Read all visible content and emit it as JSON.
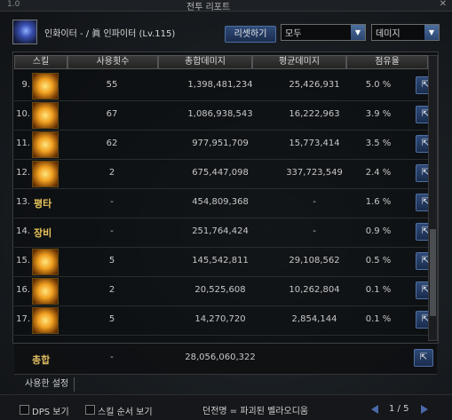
{
  "window": {
    "title": "전투 리포트",
    "version": "1.0"
  },
  "header": {
    "character": "인화이터 - / 眞 인파이터 (Lv.115)",
    "reset_label": "리셋하기",
    "filter1": "모두",
    "filter2": "데미지"
  },
  "table": {
    "columns": [
      "스킬",
      "사용횟수",
      "총합데미지",
      "평균데미지",
      "점유율"
    ],
    "rows": [
      {
        "num": "9.",
        "type": "icon",
        "name": "",
        "count": "55",
        "total": "1,398,481,234",
        "avg": "25,426,931",
        "share": "5.0 %"
      },
      {
        "num": "10.",
        "type": "icon",
        "name": "",
        "count": "67",
        "total": "1,086,938,543",
        "avg": "16,222,963",
        "share": "3.9 %"
      },
      {
        "num": "11.",
        "type": "icon",
        "name": "",
        "count": "62",
        "total": "977,951,709",
        "avg": "15,773,414",
        "share": "3.5 %"
      },
      {
        "num": "12.",
        "type": "icon",
        "name": "",
        "count": "2",
        "total": "675,447,098",
        "avg": "337,723,549",
        "share": "2.4 %"
      },
      {
        "num": "13.",
        "type": "text",
        "name": "평타",
        "count": "-",
        "total": "454,809,368",
        "avg": "-",
        "share": "1.6 %"
      },
      {
        "num": "14.",
        "type": "text",
        "name": "장비",
        "count": "-",
        "total": "251,764,424",
        "avg": "-",
        "share": "0.9 %"
      },
      {
        "num": "15.",
        "type": "icon",
        "name": "",
        "count": "5",
        "total": "145,542,811",
        "avg": "29,108,562",
        "share": "0.5 %"
      },
      {
        "num": "16.",
        "type": "icon",
        "name": "",
        "count": "2",
        "total": "20,525,608",
        "avg": "10,262,804",
        "share": "0.1 %"
      },
      {
        "num": "17.",
        "type": "icon",
        "name": "",
        "count": "5",
        "total": "14,270,720",
        "avg": "2,854,144",
        "share": "0.1 %"
      }
    ],
    "summary": {
      "label": "총합",
      "count": "-",
      "total": "28,056,060,322"
    }
  },
  "tabs": [
    "사용한 설정"
  ],
  "footer": {
    "dps_label": "DPS 보기",
    "order_label": "스킬 순서 보기",
    "dungeon": "던전명 = 파괴된 벨라오디움",
    "page": "1 / 5"
  },
  "colors": {
    "accent": "#4b69a8",
    "skill_text": "#e8c35a"
  }
}
